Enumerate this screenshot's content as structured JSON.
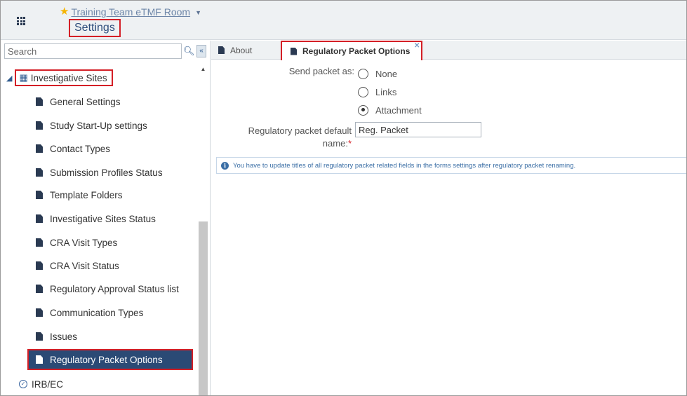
{
  "header": {
    "room_title": "Training Team eTMF Room",
    "page_title": "Settings"
  },
  "search": {
    "placeholder": "Search"
  },
  "tree": {
    "root_label": "Investigative Sites",
    "items": [
      {
        "label": "General Settings"
      },
      {
        "label": "Study Start-Up settings"
      },
      {
        "label": "Contact Types"
      },
      {
        "label": "Submission Profiles Status"
      },
      {
        "label": "Template Folders"
      },
      {
        "label": "Investigative Sites Status"
      },
      {
        "label": "CRA Visit Types"
      },
      {
        "label": "CRA Visit Status"
      },
      {
        "label": "Regulatory Approval Status list"
      },
      {
        "label": "Communication Types"
      },
      {
        "label": "Issues"
      },
      {
        "label": "Regulatory Packet Options",
        "selected": true
      }
    ],
    "next_root_label": "IRB/EC"
  },
  "tabs": [
    {
      "label": "About"
    },
    {
      "label": "Regulatory Packet Options",
      "active": true
    }
  ],
  "form": {
    "send_label": "Send packet as:",
    "options": [
      {
        "label": "None",
        "checked": false
      },
      {
        "label": "Links",
        "checked": false
      },
      {
        "label": "Attachment",
        "checked": true
      }
    ],
    "name_label": "Regulatory packet default name:",
    "required_mark": "*",
    "name_value": "Reg. Packet",
    "info_text": "You have to update titles of all regulatory packet related fields in the forms settings after regulatory packet renaming."
  },
  "colors": {
    "accent": "#2b4a75",
    "highlight_border": "#d41f26",
    "star": "#f5b400",
    "info": "#3a6ea5"
  },
  "icons": [
    "apps-grid-icon",
    "star-icon",
    "caret-down-icon",
    "search-icon",
    "collapse-left-icon",
    "site-icon",
    "document-icon",
    "check-circle-icon",
    "info-icon",
    "close-icon"
  ]
}
